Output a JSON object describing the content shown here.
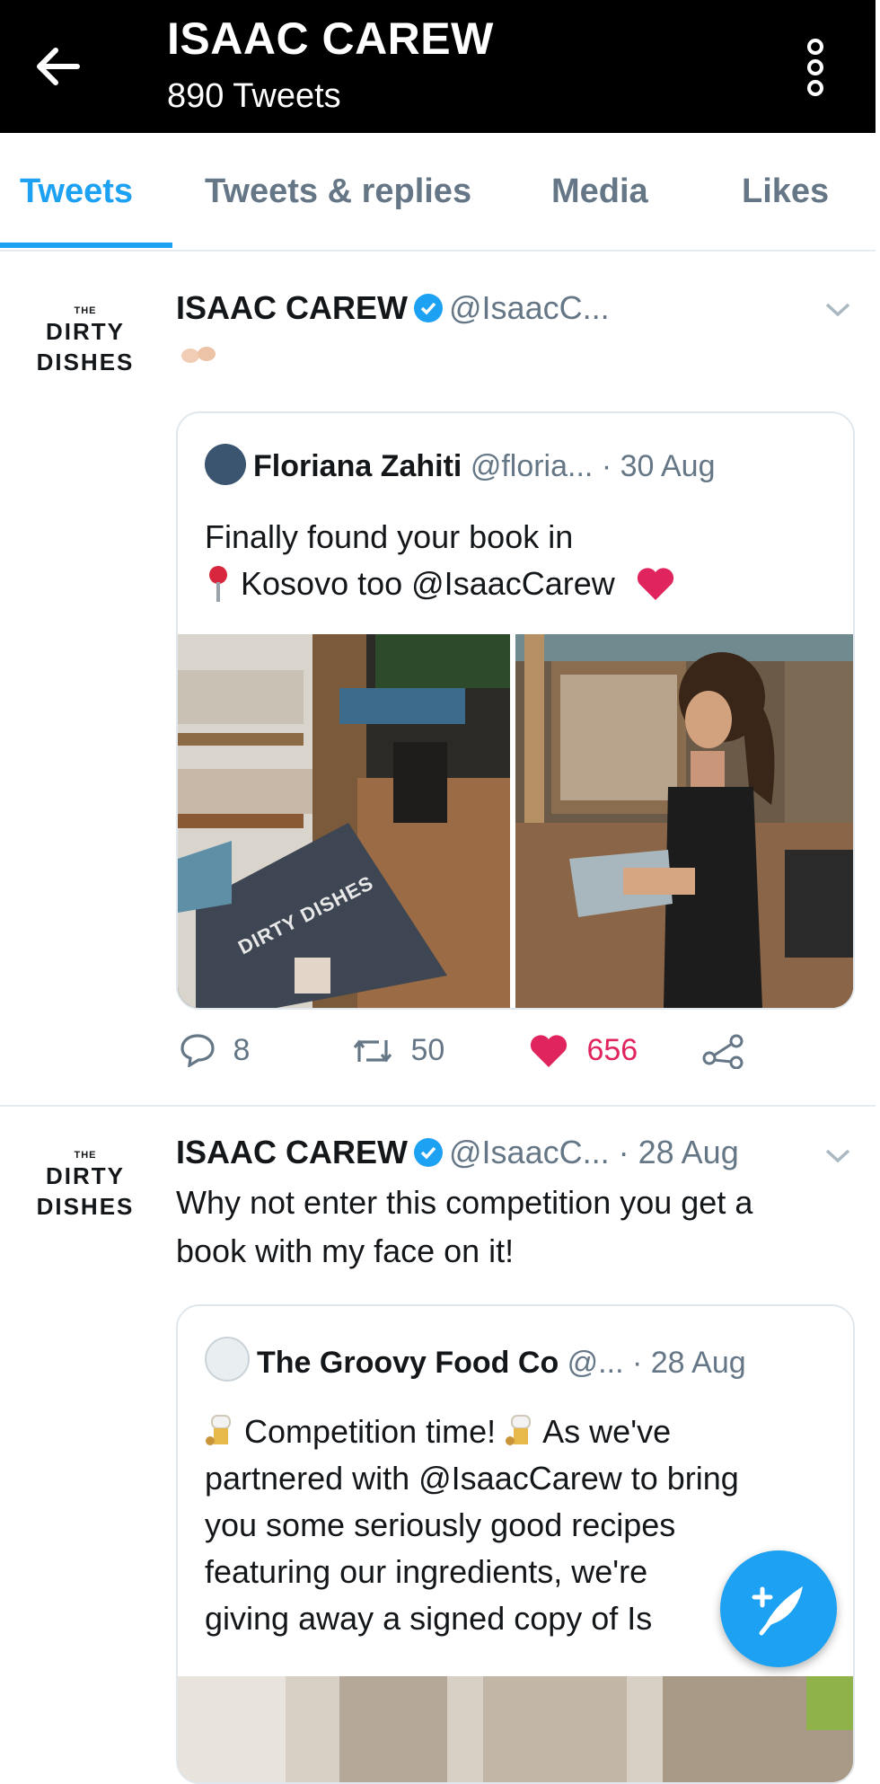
{
  "header": {
    "title": "ISAAC CAREW",
    "subtitle": "890 Tweets"
  },
  "tabs": [
    {
      "label": "Tweets",
      "active": true
    },
    {
      "label": "Tweets & replies",
      "active": false
    },
    {
      "label": "Media",
      "active": false
    },
    {
      "label": "Likes",
      "active": false
    }
  ],
  "avatar": {
    "small": "THE",
    "line1": "DIRTY",
    "line2": "DISHES"
  },
  "tweets": [
    {
      "name": "ISAAC CAREW",
      "handle": "@IsaacC...",
      "quote": {
        "name": "Floriana Zahiti",
        "handle": "@floria...",
        "date": "· 30 Aug",
        "text_line1": "Finally found your book in",
        "text_line2": "Kosovo too @IsaacCarew",
        "book_cover_title": "DIRTY DISHES"
      },
      "replies": "8",
      "retweets": "50",
      "likes": "656"
    },
    {
      "name": "ISAAC CAREW",
      "handle": "@IsaacC...",
      "date": "· 28 Aug",
      "text_line1": "Why not enter this competition you get a",
      "text_line2": "book with my face on it!",
      "quote": {
        "name": "The Groovy Food Co",
        "handle": "@...",
        "date": "· 28 Aug",
        "line1_a": "Competition time!",
        "line1_b": "As we've",
        "line2": "partnered with @IsaacCarew to bring",
        "line3": "you some seriously good recipes",
        "line4": "featuring our ingredients, we're",
        "line5": "giving away a signed copy of Is"
      }
    }
  ],
  "colors": {
    "accent": "#1da1f2",
    "like": "#e0245e",
    "muted": "#657786"
  },
  "icons": {
    "back": "arrow-left-icon",
    "more": "more-vertical-icon",
    "compose": "compose-tweet-icon"
  }
}
